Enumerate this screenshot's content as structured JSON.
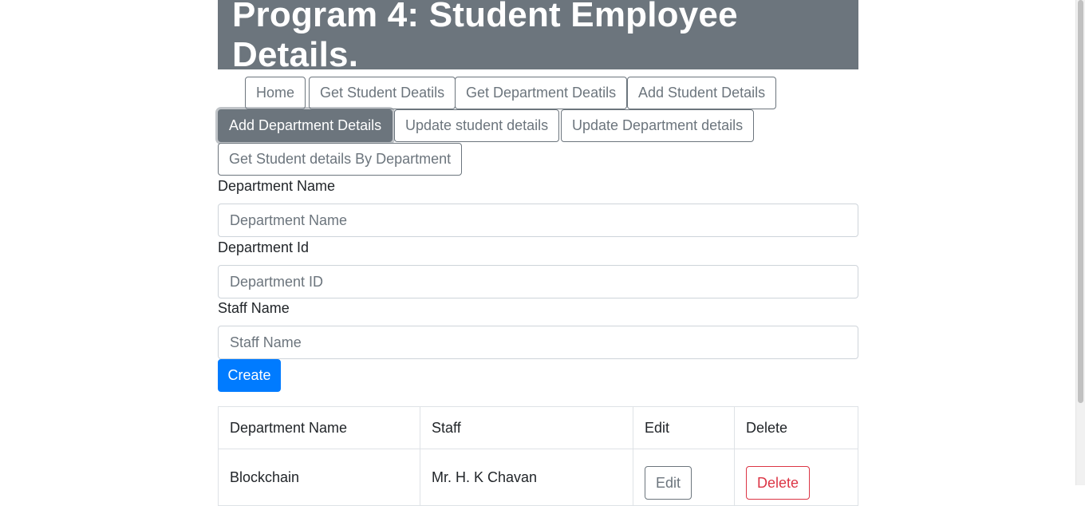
{
  "header": {
    "title": "Program 4: Student Employee Details."
  },
  "nav": {
    "home": "Home",
    "get_student": "Get Student Deatils",
    "get_department": "Get Department Deatils",
    "add_student": "Add Student Details",
    "add_department": "Add Department Details",
    "update_student": "Update student details",
    "update_department": "Update Department details",
    "get_by_department": "Get Student details By Department"
  },
  "form": {
    "dept_name_label": "Department Name",
    "dept_name_placeholder": "Department Name",
    "dept_name_value": "",
    "dept_id_label": "Department Id",
    "dept_id_placeholder": "Department ID",
    "dept_id_value": "",
    "staff_label": "Staff Name",
    "staff_placeholder": "Staff Name",
    "staff_value": "",
    "create_label": "Create"
  },
  "table": {
    "headers": [
      "Department Name",
      "Staff",
      "Edit",
      "Delete"
    ],
    "rows": [
      {
        "department": "Blockchain",
        "staff": "Mr. H. K Chavan",
        "edit": "Edit",
        "delete": "Delete"
      }
    ]
  },
  "colors": {
    "header_bg": "#6c757d",
    "primary": "#007bff",
    "danger": "#dc3545"
  }
}
